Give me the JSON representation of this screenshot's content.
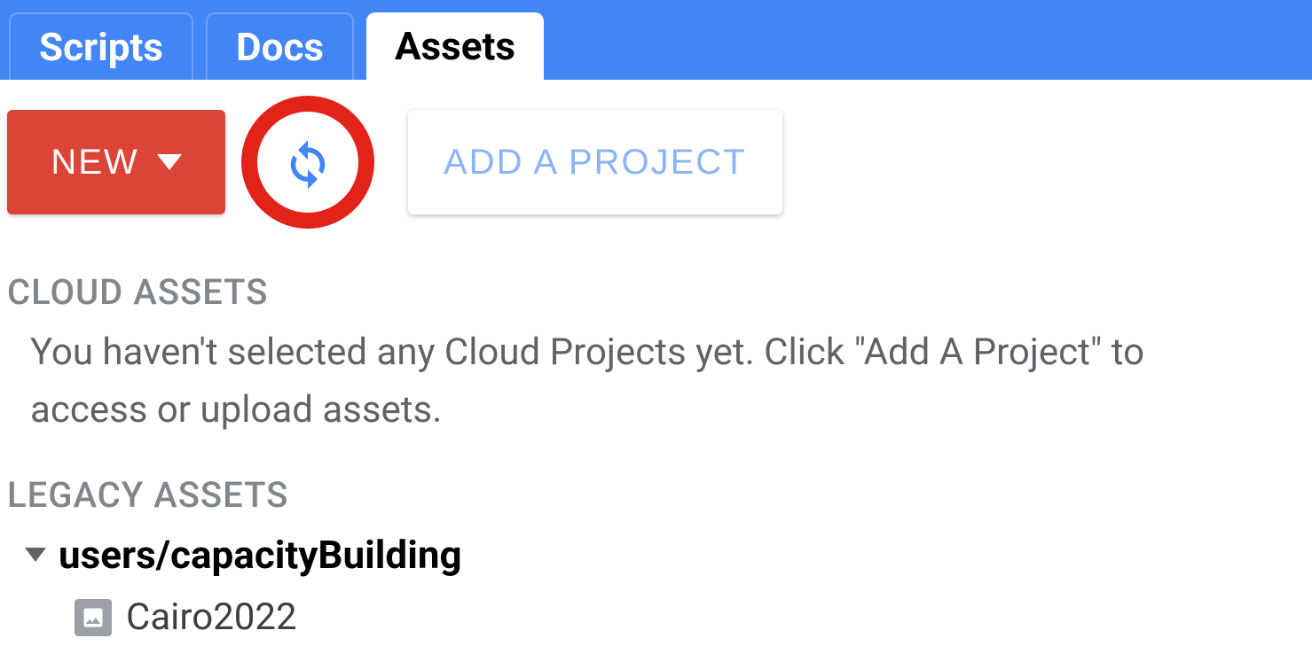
{
  "tabs": {
    "scripts": "Scripts",
    "docs": "Docs",
    "assets": "Assets"
  },
  "toolbar": {
    "new_label": "NEW",
    "add_project_label": "ADD A PROJECT"
  },
  "cloud": {
    "header": "CLOUD ASSETS",
    "message": "You haven't selected any Cloud Projects yet. Click \"Add A Project\" to access or upload assets."
  },
  "legacy": {
    "header": "LEGACY ASSETS",
    "folder": "users/capacityBuilding",
    "items": [
      {
        "name": "Cairo2022"
      }
    ]
  }
}
